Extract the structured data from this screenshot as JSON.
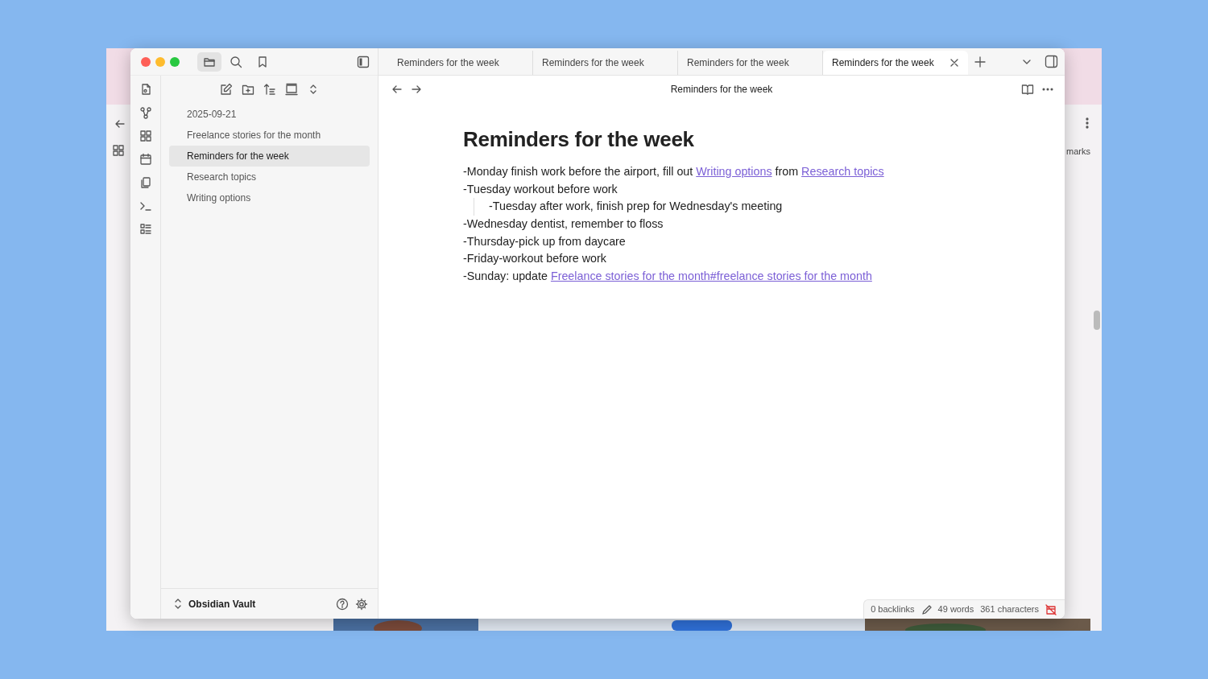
{
  "background_window": {
    "label": "marks"
  },
  "view_tabs": [
    {
      "kind": "files",
      "selected": true
    },
    {
      "kind": "search",
      "selected": false
    },
    {
      "kind": "bookmarks",
      "selected": false
    }
  ],
  "file_tree": [
    {
      "label": "2025-09-21",
      "selected": false
    },
    {
      "label": "Freelance stories for the month",
      "selected": false
    },
    {
      "label": "Reminders for the week",
      "selected": true
    },
    {
      "label": "Research topics",
      "selected": false
    },
    {
      "label": "Writing options",
      "selected": false
    }
  ],
  "vault": {
    "name": "Obsidian Vault"
  },
  "tabs": [
    {
      "label": "Reminders for the week",
      "selected": false
    },
    {
      "label": "Reminders for the week",
      "selected": false
    },
    {
      "label": "Reminders for the week",
      "selected": false
    },
    {
      "label": "Reminders for the week",
      "selected": true
    }
  ],
  "note": {
    "header_title": "Reminders for the week",
    "title": "Reminders for the week",
    "lines": [
      {
        "parts": [
          {
            "kind": "text",
            "text": "-Monday finish work before the airport, fill out "
          },
          {
            "kind": "link",
            "text": "Writing options"
          },
          {
            "kind": "text",
            "text": " from "
          },
          {
            "kind": "link",
            "text": "Research topics"
          }
        ]
      },
      {
        "parts": [
          {
            "kind": "text",
            "text": "-Tuesday workout before work"
          }
        ],
        "children": [
          {
            "parts": [
              {
                "kind": "text",
                "text": "-Tuesday after work, finish prep for Wednesday's meeting"
              }
            ]
          }
        ]
      },
      {
        "parts": [
          {
            "kind": "text",
            "text": "-Wednesday dentist, remember to floss"
          }
        ]
      },
      {
        "parts": [
          {
            "kind": "text",
            "text": "-Thursday-pick up from daycare"
          }
        ]
      },
      {
        "parts": [
          {
            "kind": "text",
            "text": "-Friday-workout before work"
          }
        ]
      },
      {
        "parts": [
          {
            "kind": "text",
            "text": "-Sunday: update "
          },
          {
            "kind": "link",
            "text": "Freelance stories for the month#freelance stories for the month"
          }
        ]
      }
    ]
  },
  "status_bar": {
    "backlinks": "0 backlinks",
    "words": "49 words",
    "characters": "361 characters"
  }
}
